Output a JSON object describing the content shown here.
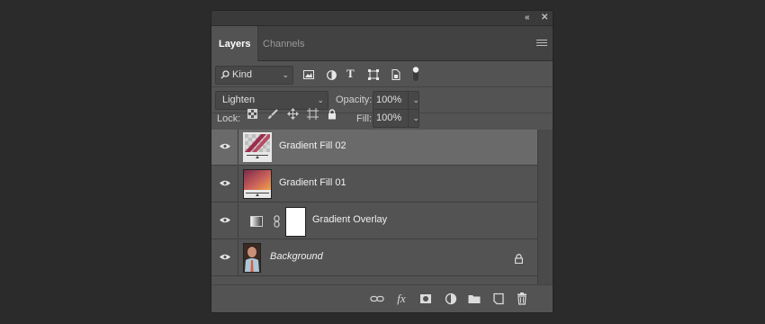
{
  "panel": {
    "collapse_label": "«",
    "close_label": "✕",
    "tabs": [
      {
        "label": "Layers",
        "active": true
      },
      {
        "label": "Channels",
        "active": false
      }
    ]
  },
  "filter": {
    "kind_label": "Kind",
    "kind_icon": "search-icon",
    "type_icon_text": "T"
  },
  "blend": {
    "mode": "Lighten",
    "opacity_label": "Opacity:",
    "opacity_value": "100%"
  },
  "lock": {
    "label": "Lock:",
    "fill_label": "Fill:",
    "fill_value": "100%"
  },
  "layers": [
    {
      "name": "Gradient Fill 02",
      "selected": true
    },
    {
      "name": "Gradient Fill 01",
      "selected": false
    },
    {
      "name": "Gradient Overlay",
      "selected": false
    },
    {
      "name": "Background",
      "selected": false,
      "italic": true,
      "locked": true
    }
  ],
  "footer": {
    "fx_label": "fx"
  },
  "colors": {
    "panel_bg": "#535353",
    "selected_row": "#6a6a6a",
    "app_bg": "#2b2b2b"
  }
}
